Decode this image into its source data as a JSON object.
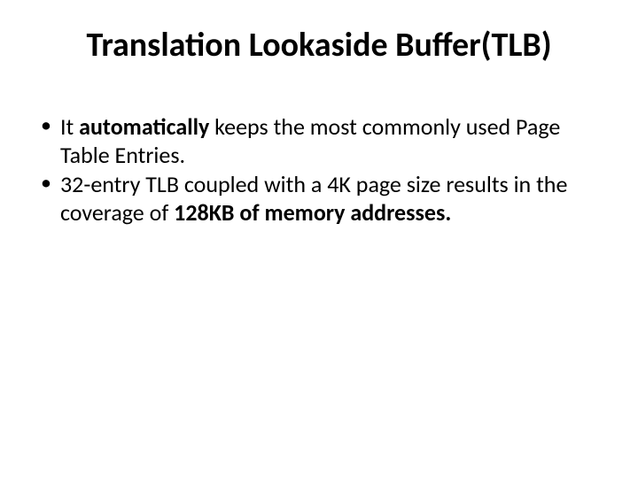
{
  "title": "Translation Lookaside Buffer(TLB)",
  "bullets": [
    {
      "pre": "It ",
      "bold1": "automatically",
      "post": " keeps the most commonly used Page Table Entries."
    },
    {
      "pre": " 32-entry TLB coupled with a 4K page size results in the coverage of ",
      "bold1": "128KB of memory addresses.",
      "post": ""
    }
  ]
}
